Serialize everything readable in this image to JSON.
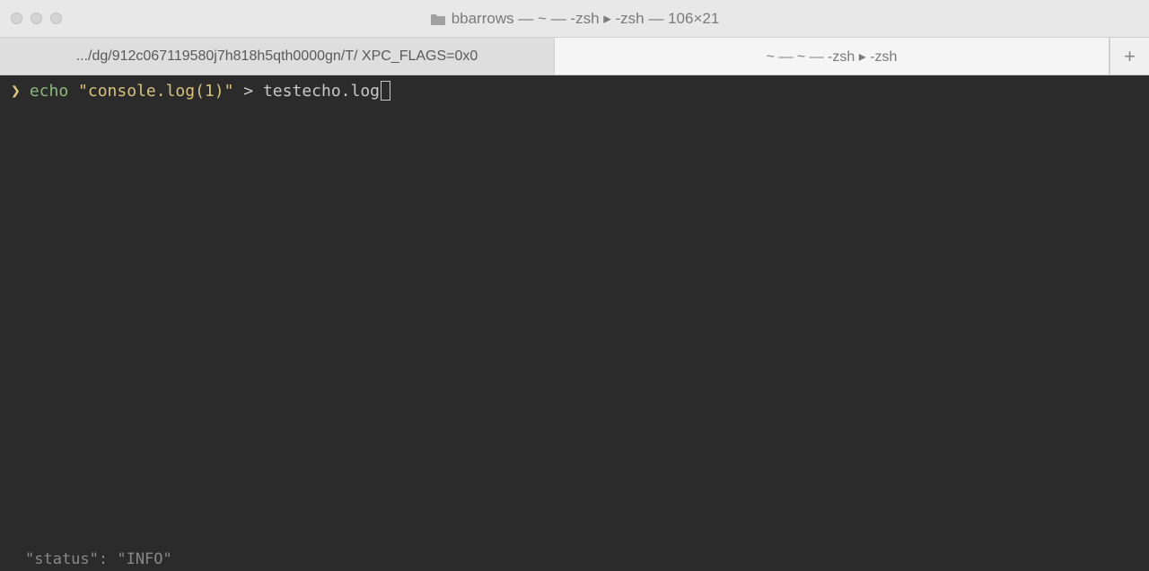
{
  "window": {
    "title": "bbarrows — ~ — -zsh ▸ -zsh — 106×21"
  },
  "tabs": [
    {
      "label": ".../dg/912c067119580j7h818h5qth0000gn/T/ XPC_FLAGS=0x0",
      "active": true
    },
    {
      "label": "~ — ~ — -zsh ▸ -zsh",
      "active": false
    }
  ],
  "tab_add": "+",
  "terminal": {
    "prompt": "❯",
    "command": {
      "word": "echo",
      "string": "\"console.log(1)\"",
      "redirect": ">",
      "target": "testecho.log"
    }
  },
  "status": "\"status\": \"INFO\""
}
